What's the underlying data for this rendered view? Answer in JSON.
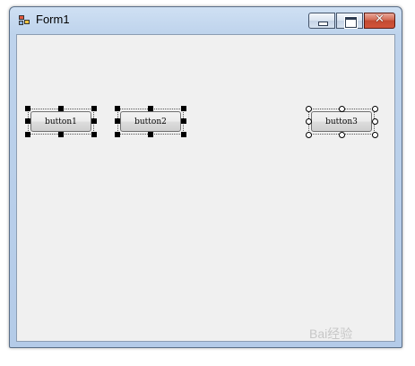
{
  "window": {
    "title": "Form1",
    "close_glyph": "✕",
    "icons": {
      "app": "form-app-icon",
      "minimize": "minimize-icon",
      "maximize": "maximize-icon",
      "close": "close-icon"
    }
  },
  "form": {
    "buttons": [
      {
        "label": "button1",
        "selection": "primary"
      },
      {
        "label": "button2",
        "selection": "primary"
      },
      {
        "label": "button3",
        "selection": "secondary"
      }
    ]
  },
  "watermark": {
    "text": "Bai经验"
  }
}
